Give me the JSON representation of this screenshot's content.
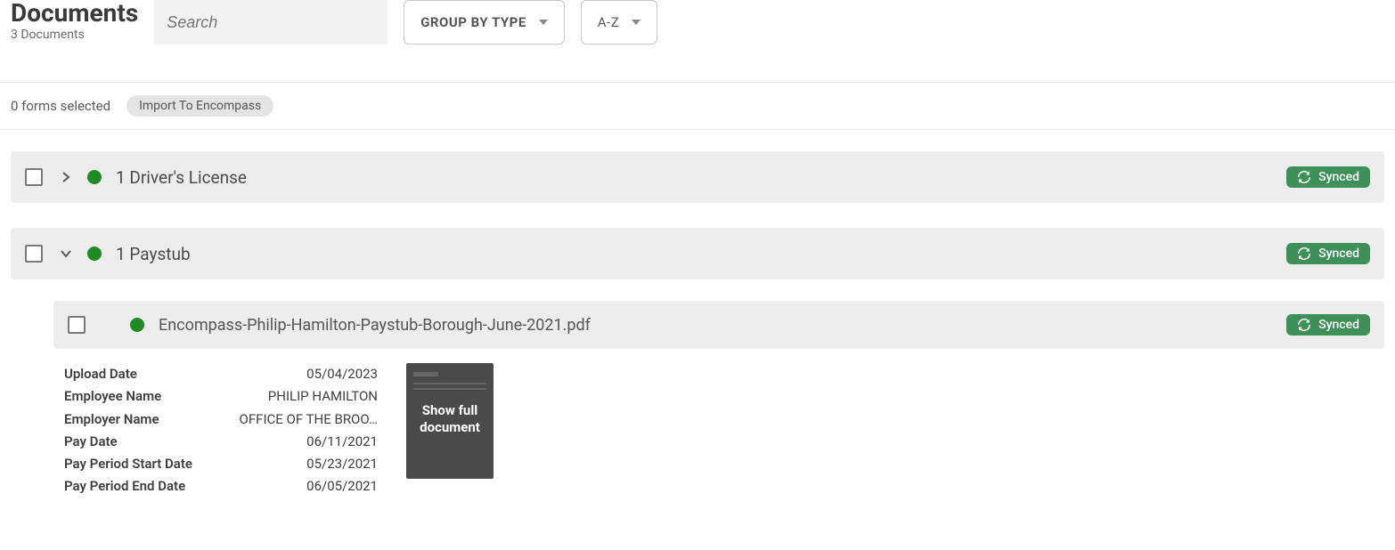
{
  "header": {
    "title": "Documents",
    "doc_count_label": "3 Documents",
    "search_placeholder": "Search",
    "group_by_label": "GROUP BY TYPE",
    "sort_label": "A-Z"
  },
  "actionbar": {
    "selection_label": "0 forms selected",
    "import_label": "Import To Encompass"
  },
  "synced_label": "Synced",
  "groups": [
    {
      "expanded": false,
      "count_and_type": "1 Driver's License",
      "synced": true
    },
    {
      "expanded": true,
      "count_and_type": "1 Paystub",
      "synced": true,
      "documents": [
        {
          "filename": "Encompass-Philip-Hamilton-Paystub-Borough-June-2021.pdf",
          "synced": true,
          "thumb_label": "Show full document",
          "details": [
            {
              "label": "Upload Date",
              "value": "05/04/2023"
            },
            {
              "label": "Employee Name",
              "value": "PHILIP HAMILTON"
            },
            {
              "label": "Employer Name",
              "value": "OFFICE OF THE BROO…"
            },
            {
              "label": "Pay Date",
              "value": "06/11/2021"
            },
            {
              "label": "Pay Period Start Date",
              "value": "05/23/2021"
            },
            {
              "label": "Pay Period End Date",
              "value": "06/05/2021"
            }
          ]
        }
      ]
    }
  ]
}
